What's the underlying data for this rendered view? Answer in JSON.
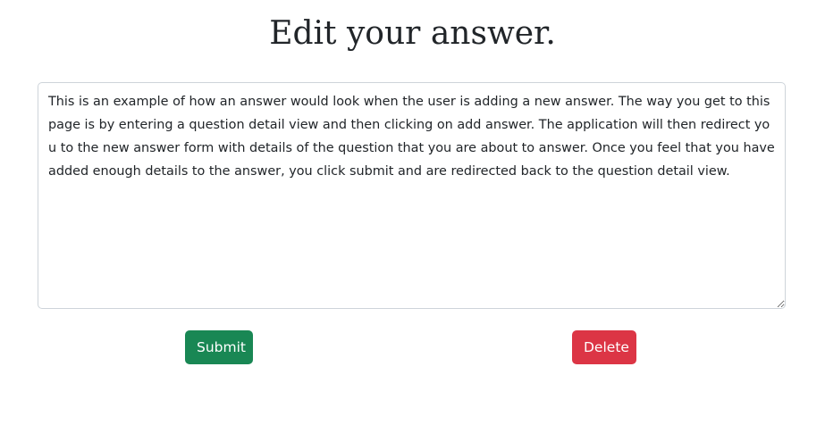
{
  "page": {
    "title": "Edit your answer."
  },
  "form": {
    "answer_text": "This is an example of how an answer would look when the user is adding a new answer. The way you get to this page is by entering a question detail view and then clicking on add answer. The application will then redirect you to the new answer form with details of the question that you are about to answer. Once you feel that you have added enough details to the answer, you click submit and are redirected back to the question detail view.",
    "submit_label": "Submit",
    "delete_label": "Delete"
  },
  "colors": {
    "submit": "#198754",
    "delete": "#dc3545"
  }
}
